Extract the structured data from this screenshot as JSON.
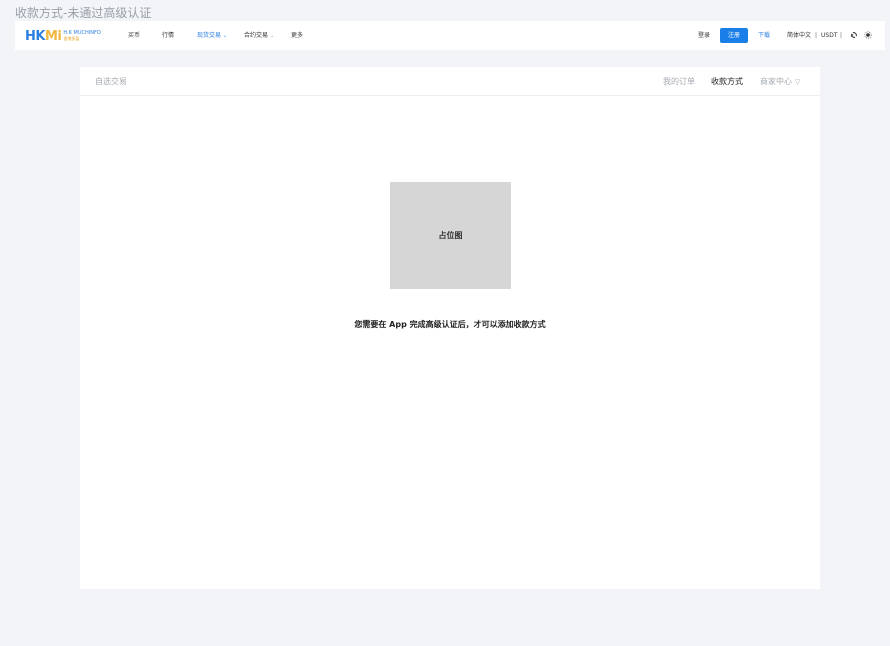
{
  "page_label": "收款方式-未通过高级认证",
  "logo": {
    "mark_hk": "HK",
    "mark_mi": "Mi",
    "name_en": "H.K MUCHINFO",
    "name_cn": "香港多盈"
  },
  "nav": {
    "items": [
      {
        "label": "买币"
      },
      {
        "label": "行情"
      },
      {
        "label": "现货交易",
        "dropdown": true,
        "active": true
      },
      {
        "label": "合约交易",
        "dropdown": true
      },
      {
        "label": "更多"
      }
    ],
    "caret": "⌄"
  },
  "right_nav": {
    "login": "登录",
    "register": "注册",
    "download": "下载",
    "language": "简体中文",
    "separator": "|",
    "currency": "USDT",
    "icons": [
      "link-icon",
      "theme-icon"
    ]
  },
  "card": {
    "left_tab": "自选交易",
    "tabs": [
      {
        "label": "我的订单",
        "active": false
      },
      {
        "label": "收款方式",
        "active": true
      },
      {
        "label": "商家中心",
        "active": false,
        "dropdown": true
      }
    ],
    "tab_caret": "▽",
    "placeholder_label": "占位图",
    "notice": "您需要在 App 完成高级认证后，才可以添加收款方式"
  },
  "colors": {
    "accent": "#1a7ee8",
    "background": "#f2f4f7",
    "placeholder": "#d6d6d6",
    "muted_text": "#a4a9b0"
  }
}
